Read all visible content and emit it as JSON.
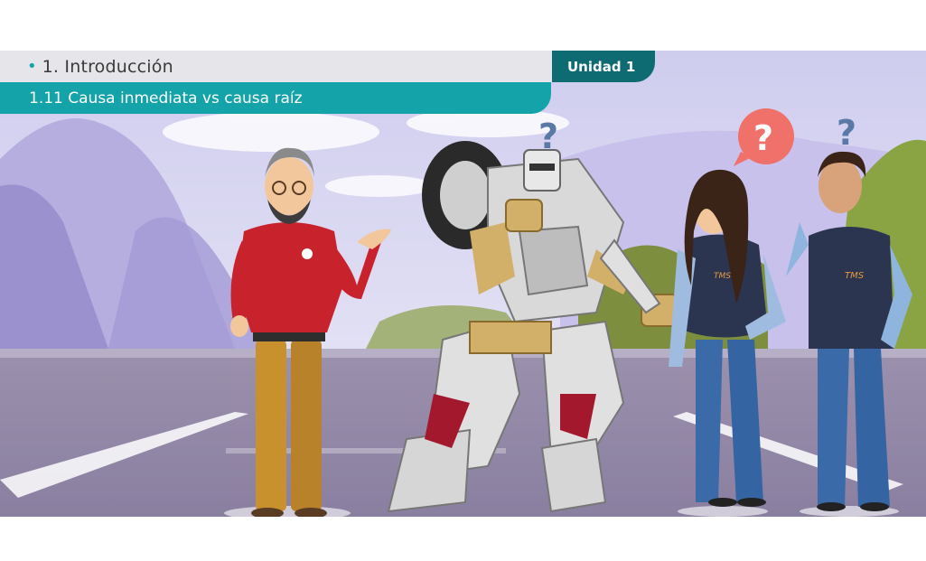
{
  "header": {
    "section_title": "1. Introducción",
    "unit_label": "Unidad 1",
    "subtitle": "1.11 Causa inmediata vs causa raíz"
  },
  "scene": {
    "question_mark": "?",
    "badge_text": "TMS"
  },
  "colors": {
    "teal": "#14a3a8",
    "dark_teal": "#0f6b72",
    "header_gray": "#e6e6ea",
    "speech_bubble": "#f0706a",
    "question_blue": "#5b79a6"
  }
}
